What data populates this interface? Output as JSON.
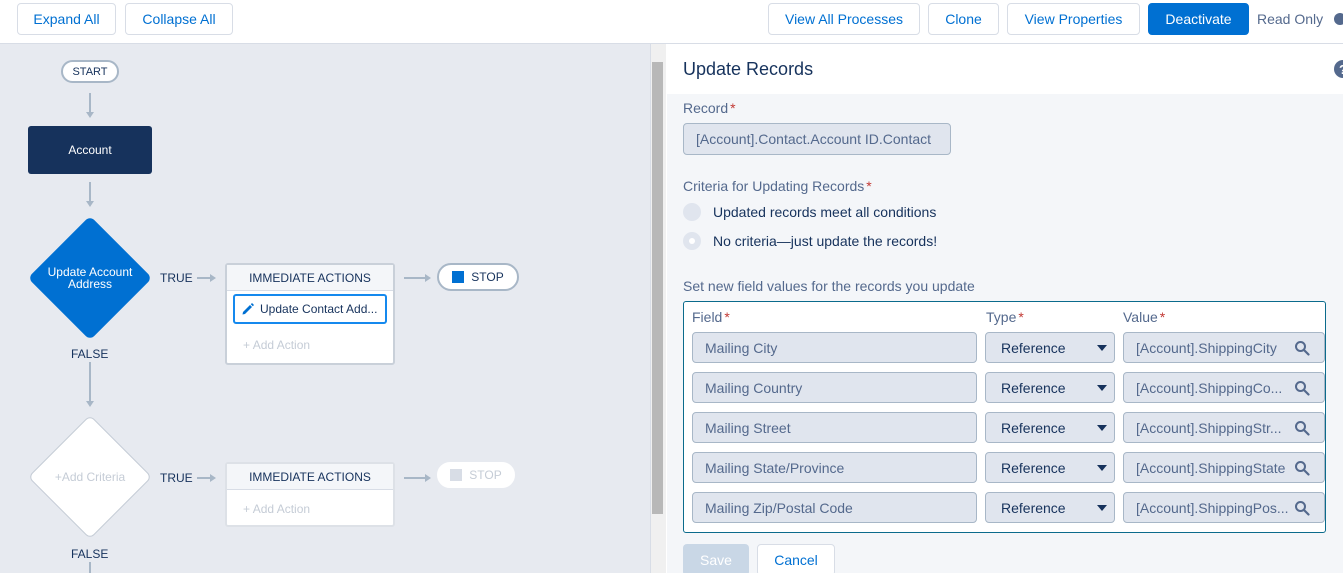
{
  "toolbar": {
    "expand_all": "Expand All",
    "collapse_all": "Collapse All",
    "view_all_processes": "View All Processes",
    "clone": "Clone",
    "view_properties": "View Properties",
    "deactivate": "Deactivate",
    "read_only": "Read Only"
  },
  "canvas": {
    "start": "START",
    "object_node": "Account",
    "criteria_1": {
      "label": "Update Account Address",
      "true_label": "TRUE",
      "false_label": "FALSE"
    },
    "actions_1": {
      "header": "IMMEDIATE ACTIONS",
      "item": "Update Contact Add...",
      "add_action": "Add Action"
    },
    "stop_1": "STOP",
    "criteria_2": {
      "label": "Add Criteria",
      "true_label": "TRUE",
      "false_label": "FALSE"
    },
    "actions_2": {
      "header": "IMMEDIATE ACTIONS",
      "add_action": "Add Action"
    },
    "stop_2": "STOP"
  },
  "panel": {
    "title": "Update Records",
    "help": "?",
    "record_label": "Record",
    "record_value": "[Account].Contact.Account ID.Contact",
    "criteria_label": "Criteria for Updating Records",
    "criteria_options": [
      {
        "label": "Updated records meet all conditions",
        "selected": false
      },
      {
        "label": "No criteria—just update the records!",
        "selected": true
      }
    ],
    "set_values_label": "Set new field values for the records you update",
    "columns": {
      "field": "Field",
      "type": "Type",
      "value": "Value"
    },
    "rows": [
      {
        "field": "Mailing City",
        "type": "Reference",
        "value": "[Account].ShippingCity"
      },
      {
        "field": "Mailing Country",
        "type": "Reference",
        "value": "[Account].ShippingCo..."
      },
      {
        "field": "Mailing Street",
        "type": "Reference",
        "value": "[Account].ShippingStr..."
      },
      {
        "field": "Mailing State/Province",
        "type": "Reference",
        "value": "[Account].ShippingState"
      },
      {
        "field": "Mailing Zip/Postal Code",
        "type": "Reference",
        "value": "[Account].ShippingPos..."
      }
    ],
    "save": "Save",
    "cancel": "Cancel"
  },
  "colors": {
    "brand": "#0070d2",
    "navy": "#16325c",
    "canvas_bg": "#e7eaf0"
  }
}
